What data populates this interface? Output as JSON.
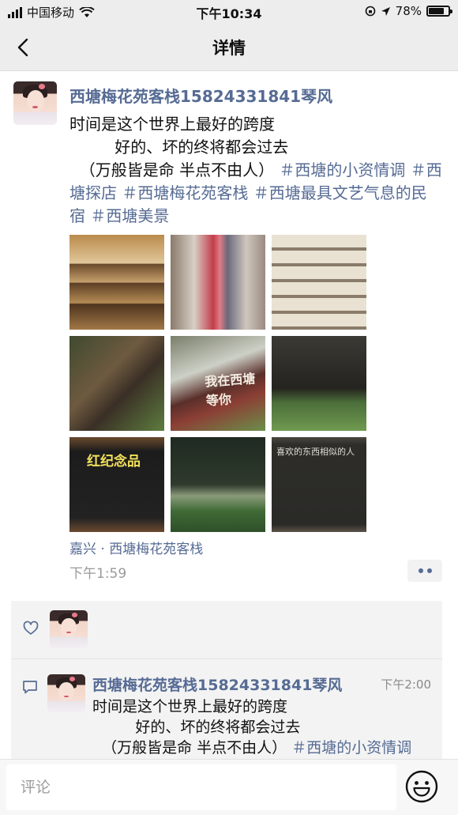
{
  "status_bar": {
    "carrier": "中国移动",
    "time": "下午10:34",
    "battery": "78%",
    "battery_level": 0.78
  },
  "nav": {
    "title": "详情"
  },
  "post": {
    "author": "西塘梅花苑客栈15824331841琴风",
    "text_plain": "时间是这个世界上最好的跨度\n         好的、坏的终将都会过去\n  （万般皆是命 半点不由人）",
    "hashtags": [
      "＃西塘的小资情调",
      "＃西塘探店",
      "＃西塘梅花苑客栈",
      "＃西塘最具文艺气息的民宿",
      "＃西塘美景"
    ],
    "photo_sign_text": "我在西塘等你",
    "photo_board_text": "红纪念品",
    "photo_chalk_text": "喜欢的东西相似的人",
    "location": "嘉兴 · 西塘梅花苑客栈",
    "time": "下午1:59"
  },
  "comment": {
    "author": "西塘梅花苑客栈15824331841琴风",
    "time": "下午2:00",
    "text_plain": "时间是这个世界上最好的跨度\n         好的、坏的终将都会过去\n  （万般皆是命 半点不由人）",
    "hashtag": "＃西塘的小资情调"
  },
  "input": {
    "placeholder": "评论"
  },
  "icons": {
    "back": "back-chevron-icon",
    "more": "more-dots-icon",
    "like": "heart-icon",
    "comment": "comment-bubble-icon",
    "emoji": "smiley-face-icon"
  },
  "colors": {
    "link": "#566b94",
    "bar_bg": "#ededed",
    "muted": "#9a9a9a"
  }
}
